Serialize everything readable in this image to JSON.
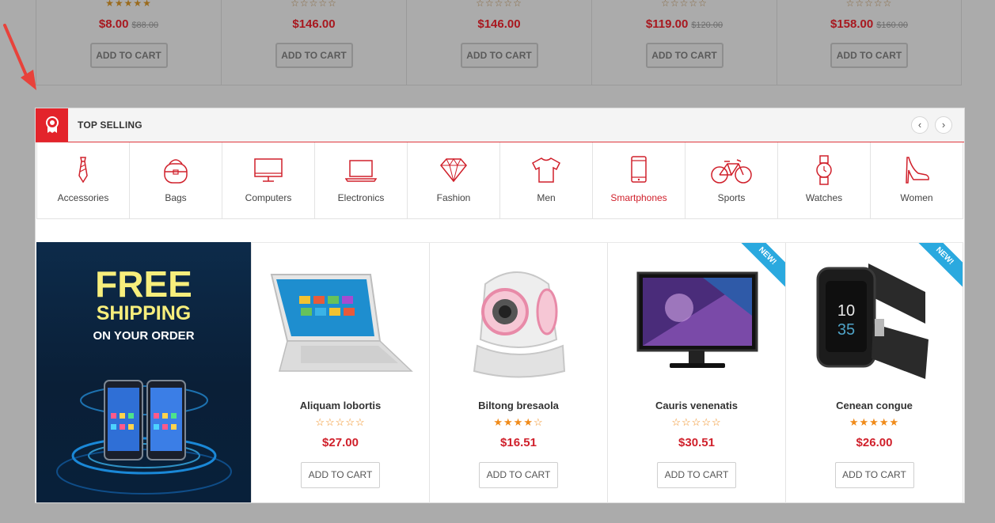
{
  "top_products": [
    {
      "stars": "★★★★★",
      "price": "$8.00",
      "old_price": "$88.00",
      "button": "ADD TO CART"
    },
    {
      "stars": "☆☆☆☆☆",
      "price": "$146.00",
      "old_price": "",
      "button": "ADD TO CART"
    },
    {
      "stars": "☆☆☆☆☆",
      "price": "$146.00",
      "old_price": "",
      "button": "ADD TO CART"
    },
    {
      "stars": "☆☆☆☆☆",
      "price": "$119.00",
      "old_price": "$120.00",
      "button": "ADD TO CART"
    },
    {
      "stars": "☆☆☆☆☆",
      "price": "$158.00",
      "old_price": "$160.00",
      "button": "ADD TO CART"
    }
  ],
  "module": {
    "title": "TOP SELLING",
    "prev": "‹",
    "next": "›",
    "active_color": "#d0202b",
    "accent": "#e3242b"
  },
  "categories": [
    {
      "label": "Accessories",
      "icon": "tie-icon"
    },
    {
      "label": "Bags",
      "icon": "bag-icon"
    },
    {
      "label": "Computers",
      "icon": "monitor-icon"
    },
    {
      "label": "Electronics",
      "icon": "laptop-icon"
    },
    {
      "label": "Fashion",
      "icon": "diamond-icon"
    },
    {
      "label": "Men",
      "icon": "tshirt-icon"
    },
    {
      "label": "Smartphones",
      "icon": "smartphone-icon",
      "active": true
    },
    {
      "label": "Sports",
      "icon": "bicycle-icon"
    },
    {
      "label": "Watches",
      "icon": "watch-icon"
    },
    {
      "label": "Women",
      "icon": "high-heel-icon"
    }
  ],
  "banner": {
    "line1": "FREE",
    "line2": "SHIPPING",
    "line3": "ON YOUR ORDER"
  },
  "products": [
    {
      "name": "Aliquam lobortis",
      "stars": "☆☆☆☆☆",
      "price": "$27.00",
      "button": "ADD TO CART",
      "badge": "",
      "image": "laptop"
    },
    {
      "name": "Biltong bresaola",
      "stars": "★★★★☆",
      "price": "$16.51",
      "button": "ADD TO CART",
      "badge": "",
      "image": "camera"
    },
    {
      "name": "Cauris venenatis",
      "stars": "☆☆☆☆☆",
      "price": "$30.51",
      "button": "ADD TO CART",
      "badge": "NEW!",
      "image": "monitor"
    },
    {
      "name": "Cenean congue",
      "stars": "★★★★★",
      "price": "$26.00",
      "button": "ADD TO CART",
      "badge": "NEW!",
      "image": "smartwatch",
      "watch_time_hour": "10",
      "watch_time_min": "35"
    }
  ]
}
